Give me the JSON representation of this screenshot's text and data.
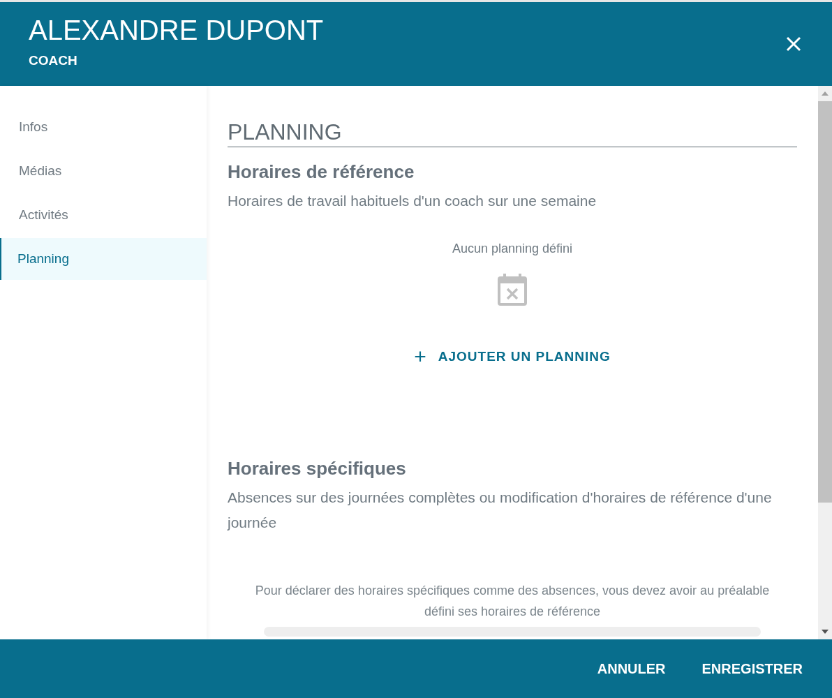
{
  "header": {
    "title": "ALEXANDRE DUPONT",
    "subtitle": "COACH"
  },
  "sidebar": {
    "items": [
      {
        "label": "Infos",
        "selected": false
      },
      {
        "label": "Médias",
        "selected": false
      },
      {
        "label": "Activités",
        "selected": false
      },
      {
        "label": "Planning",
        "selected": true
      }
    ]
  },
  "content": {
    "title": "PLANNING",
    "sections": [
      {
        "heading": "Horaires de référence",
        "description": "Horaires de travail habituels d'un coach sur une semaine",
        "empty_text": "Aucun planning défini",
        "action": {
          "icon": "+",
          "label": "AJOUTER UN PLANNING"
        }
      },
      {
        "heading": "Horaires spécifiques",
        "description": "Absences sur des journées complètes ou modification d'horaires de référence d'une journée",
        "note": "Pour déclarer des horaires spécifiques comme des absences, vous devez avoir au préalable défini ses horaires de référence"
      }
    ]
  },
  "footer": {
    "buttons": [
      "ANNULER",
      "ENREGISTRER"
    ]
  }
}
